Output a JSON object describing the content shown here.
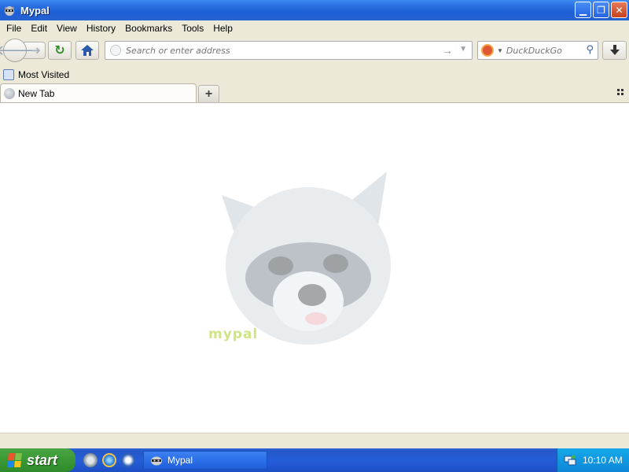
{
  "window": {
    "title": "Mypal",
    "app_icon": "raccoon-icon",
    "controls": [
      "minimize-icon",
      "restore-icon",
      "close-icon"
    ]
  },
  "menubar": {
    "items": [
      "File",
      "Edit",
      "View",
      "History",
      "Bookmarks",
      "Tools",
      "Help"
    ]
  },
  "navbar": {
    "back_icon": "back-arrow-icon",
    "forward_icon": "forward-arrow-icon",
    "reload_icon": "reload-icon",
    "home_icon": "home-icon",
    "url_placeholder": "Search or enter address",
    "url_value": "",
    "go_icon": "go-arrow-icon",
    "search_engine_icon": "duckduckgo-icon",
    "search_placeholder": "DuckDuckGo",
    "search_icon": "magnifier-icon",
    "download_icon": "download-icon"
  },
  "bookmarks": {
    "items": [
      {
        "label": "Most Visited",
        "icon": "bookmark-folder-icon"
      }
    ]
  },
  "tabs": {
    "items": [
      {
        "label": "New Tab",
        "active": true,
        "icon": "globe-icon"
      }
    ],
    "new_tab_label": "+",
    "list_all_icon": "tab-grid-icon"
  },
  "content": {
    "logo_text": "mypal",
    "logo_icon": "raccoon-logo-icon"
  },
  "taskbar": {
    "start_label": "start",
    "quick_launch": [
      "mypal-quicklaunch-icon",
      "ie-icon",
      "media-player-icon"
    ],
    "tasks": [
      {
        "label": "Mypal",
        "icon": "raccoon-icon"
      }
    ],
    "tray_icon": "network-icon",
    "clock": "10:10 AM"
  },
  "colors": {
    "titlebar": "#245dd9",
    "start_button": "#3c9b37",
    "tray": "#0d87d6"
  }
}
